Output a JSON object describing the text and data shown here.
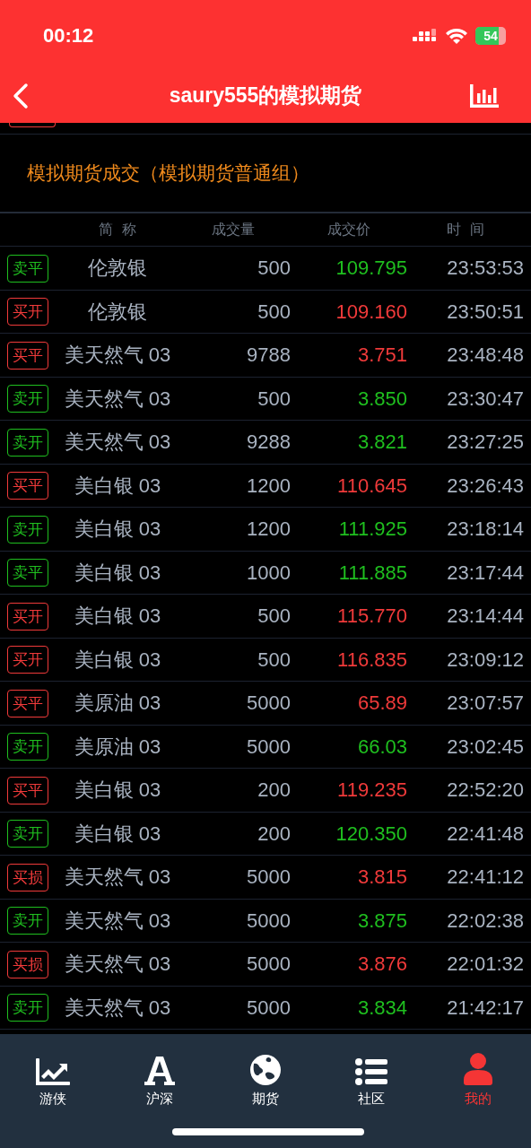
{
  "status_bar": {
    "time": "00:12",
    "battery": "54"
  },
  "nav": {
    "title": "saury555的模拟期货"
  },
  "partial_row": {
    "color": "#f03a3a"
  },
  "section_title": "模拟期货成交（模拟期货普通组）",
  "table": {
    "columns": [
      "简  称",
      "成交量",
      "成交价",
      "时  间"
    ],
    "rows": [
      {
        "action": "卖平",
        "color": "#1fbf1f",
        "name": "伦敦银",
        "volume": "500",
        "price": "109.795",
        "time": "23:53:53"
      },
      {
        "action": "买开",
        "color": "#f03a3a",
        "name": "伦敦银",
        "volume": "500",
        "price": "109.160",
        "time": "23:50:51"
      },
      {
        "action": "买平",
        "color": "#f03a3a",
        "name": "美天然气 03",
        "volume": "9788",
        "price": "3.751",
        "time": "23:48:48"
      },
      {
        "action": "卖开",
        "color": "#1fbf1f",
        "name": "美天然气 03",
        "volume": "500",
        "price": "3.850",
        "time": "23:30:47"
      },
      {
        "action": "卖开",
        "color": "#1fbf1f",
        "name": "美天然气 03",
        "volume": "9288",
        "price": "3.821",
        "time": "23:27:25"
      },
      {
        "action": "买平",
        "color": "#f03a3a",
        "name": "美白银 03",
        "volume": "1200",
        "price": "110.645",
        "time": "23:26:43"
      },
      {
        "action": "卖开",
        "color": "#1fbf1f",
        "name": "美白银 03",
        "volume": "1200",
        "price": "111.925",
        "time": "23:18:14"
      },
      {
        "action": "卖平",
        "color": "#1fbf1f",
        "name": "美白银 03",
        "volume": "1000",
        "price": "111.885",
        "time": "23:17:44"
      },
      {
        "action": "买开",
        "color": "#f03a3a",
        "name": "美白银 03",
        "volume": "500",
        "price": "115.770",
        "time": "23:14:44"
      },
      {
        "action": "买开",
        "color": "#f03a3a",
        "name": "美白银 03",
        "volume": "500",
        "price": "116.835",
        "time": "23:09:12"
      },
      {
        "action": "买平",
        "color": "#f03a3a",
        "name": "美原油 03",
        "volume": "5000",
        "price": "65.89",
        "time": "23:07:57"
      },
      {
        "action": "卖开",
        "color": "#1fbf1f",
        "name": "美原油 03",
        "volume": "5000",
        "price": "66.03",
        "time": "23:02:45"
      },
      {
        "action": "买平",
        "color": "#f03a3a",
        "name": "美白银 03",
        "volume": "200",
        "price": "119.235",
        "time": "22:52:20"
      },
      {
        "action": "卖开",
        "color": "#1fbf1f",
        "name": "美白银 03",
        "volume": "200",
        "price": "120.350",
        "time": "22:41:48"
      },
      {
        "action": "买损",
        "color": "#f03a3a",
        "name": "美天然气 03",
        "volume": "5000",
        "price": "3.815",
        "time": "22:41:12"
      },
      {
        "action": "卖开",
        "color": "#1fbf1f",
        "name": "美天然气 03",
        "volume": "5000",
        "price": "3.875",
        "time": "22:02:38"
      },
      {
        "action": "买损",
        "color": "#f03a3a",
        "name": "美天然气 03",
        "volume": "5000",
        "price": "3.876",
        "time": "22:01:32"
      },
      {
        "action": "卖开",
        "color": "#1fbf1f",
        "name": "美天然气 03",
        "volume": "5000",
        "price": "3.834",
        "time": "21:42:17"
      }
    ]
  },
  "tab_bar": [
    {
      "label": "游侠",
      "selected": false
    },
    {
      "label": "沪深",
      "selected": false
    },
    {
      "label": "期货",
      "selected": false
    },
    {
      "label": "社区",
      "selected": false
    },
    {
      "label": "我的",
      "selected": true
    }
  ]
}
